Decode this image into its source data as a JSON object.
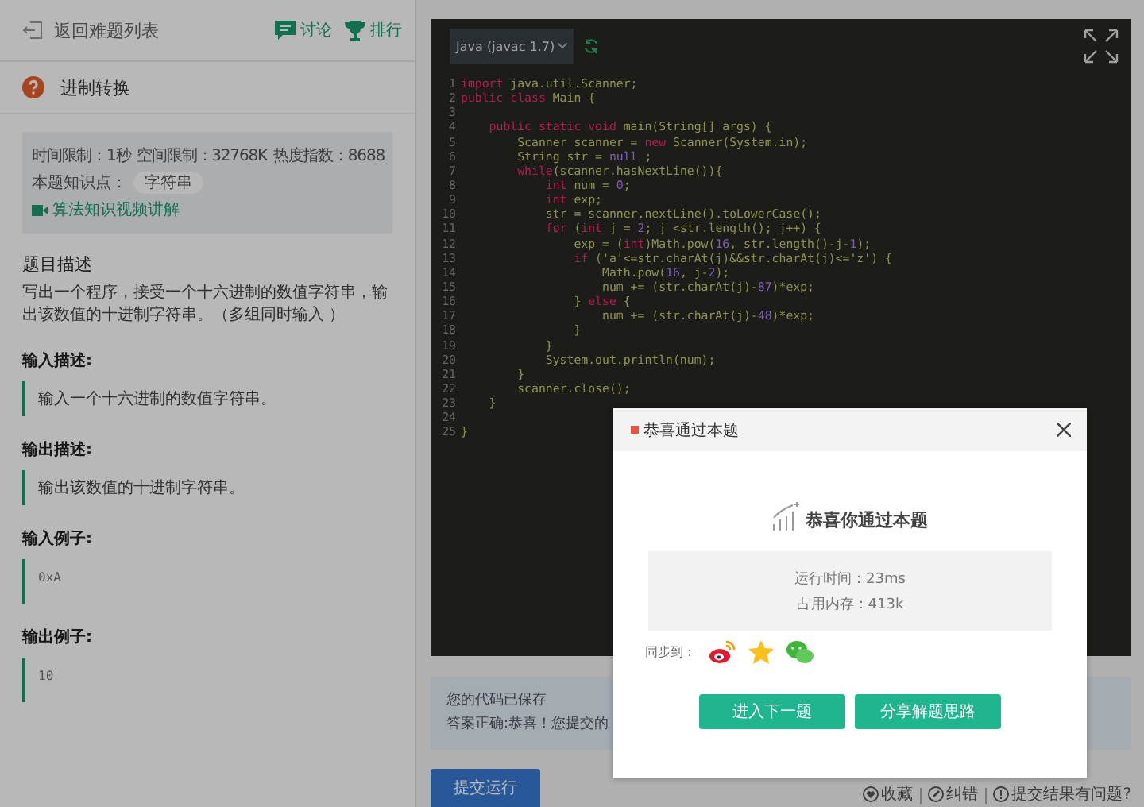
{
  "header": {
    "back_link": "返回难题列表",
    "discuss_link": "讨论",
    "rank_link": "排行"
  },
  "problem": {
    "title": "进制转换",
    "time_limit": "时间限制：1秒",
    "space_limit": "空间限制：32768K",
    "heat_index": "热度指数：8688",
    "knowledge_label": "本题知识点：",
    "knowledge_tag": "字符串",
    "video_link": "算法知识视频讲解"
  },
  "description": {
    "heading": "题目描述",
    "text": "写出一个程序，接受一个十六进制的数值字符串，输出该数值的十进制字符串。（多组同时输入 ）"
  },
  "sections": [
    {
      "heading": "输入描述:",
      "kind": "prose",
      "body": "输入一个十六进制的数值字符串。"
    },
    {
      "heading": "输出描述:",
      "kind": "prose",
      "body": "输出该数值的十进制字符串。"
    },
    {
      "heading": "输入例子:",
      "kind": "code",
      "body": "0xA"
    },
    {
      "heading": "输出例子:",
      "kind": "code",
      "body": "10"
    }
  ],
  "editor": {
    "language": "Java (javac 1.7)",
    "lines": [
      {
        "number": "1",
        "segments": [
          {
            "text": "import",
            "kind": "keyword"
          },
          {
            "text": " java.util.Scanner;",
            "kind": "plain"
          }
        ]
      },
      {
        "number": "2",
        "segments": [
          {
            "text": "public class",
            "kind": "keyword"
          },
          {
            "text": " Main {",
            "kind": "plain"
          }
        ]
      },
      {
        "number": "3"
      },
      {
        "number": "4",
        "segments": [
          {
            "text": "    public static void",
            "kind": "keyword"
          },
          {
            "text": " main(String[] args) {",
            "kind": "plain"
          }
        ]
      },
      {
        "number": "5",
        "segments": [
          {
            "text": "        Scanner scanner = ",
            "kind": "plain"
          },
          {
            "text": "new",
            "kind": "keyword"
          },
          {
            "text": " Scanner(System.in);",
            "kind": "plain"
          }
        ]
      },
      {
        "number": "6",
        "segments": [
          {
            "text": "        String str = ",
            "kind": "plain"
          },
          {
            "text": "null",
            "kind": "number"
          },
          {
            "text": " ;",
            "kind": "plain"
          }
        ]
      },
      {
        "number": "7",
        "segments": [
          {
            "text": "        while",
            "kind": "keyword"
          },
          {
            "text": "(scanner.hasNextLine()){",
            "kind": "plain"
          }
        ]
      },
      {
        "number": "8",
        "segments": [
          {
            "text": "            int",
            "kind": "keyword"
          },
          {
            "text": " num = ",
            "kind": "plain"
          },
          {
            "text": "0",
            "kind": "number"
          },
          {
            "text": ";",
            "kind": "plain"
          }
        ]
      },
      {
        "number": "9",
        "segments": [
          {
            "text": "            int",
            "kind": "keyword"
          },
          {
            "text": " exp;",
            "kind": "plain"
          }
        ]
      },
      {
        "number": "10",
        "segments": [
          {
            "text": "            str = scanner.nextLine().toLowerCase();",
            "kind": "plain"
          }
        ]
      },
      {
        "number": "11",
        "segments": [
          {
            "text": "            for",
            "kind": "keyword"
          },
          {
            "text": " (",
            "kind": "plain"
          },
          {
            "text": "int",
            "kind": "keyword"
          },
          {
            "text": " j = ",
            "kind": "plain"
          },
          {
            "text": "2",
            "kind": "number"
          },
          {
            "text": "; j <str.length(); j++) {",
            "kind": "plain"
          }
        ]
      },
      {
        "number": "12",
        "segments": [
          {
            "text": "                exp = (",
            "kind": "plain"
          },
          {
            "text": "int",
            "kind": "keyword"
          },
          {
            "text": ")Math.pow(",
            "kind": "plain"
          },
          {
            "text": "16",
            "kind": "number"
          },
          {
            "text": ", str.length()-j-",
            "kind": "plain"
          },
          {
            "text": "1",
            "kind": "number"
          },
          {
            "text": ");",
            "kind": "plain"
          }
        ]
      },
      {
        "number": "13",
        "segments": [
          {
            "text": "                if",
            "kind": "keyword"
          },
          {
            "text": " ('a'<=str.charAt(j)&&str.charAt(j)<='z') {",
            "kind": "plain"
          }
        ]
      },
      {
        "number": "14",
        "segments": [
          {
            "text": "                    Math.pow(",
            "kind": "plain"
          },
          {
            "text": "16",
            "kind": "number"
          },
          {
            "text": ", j-",
            "kind": "plain"
          },
          {
            "text": "2",
            "kind": "number"
          },
          {
            "text": ");",
            "kind": "plain"
          }
        ]
      },
      {
        "number": "15",
        "segments": [
          {
            "text": "                    num += (str.charAt(j)-",
            "kind": "plain"
          },
          {
            "text": "87",
            "kind": "number"
          },
          {
            "text": ")*exp;",
            "kind": "plain"
          }
        ]
      },
      {
        "number": "16",
        "segments": [
          {
            "text": "                } ",
            "kind": "plain"
          },
          {
            "text": "else",
            "kind": "keyword"
          },
          {
            "text": " {",
            "kind": "plain"
          }
        ]
      },
      {
        "number": "17",
        "segments": [
          {
            "text": "                    num += (str.charAt(j)-",
            "kind": "plain"
          },
          {
            "text": "48",
            "kind": "number"
          },
          {
            "text": ")*exp;",
            "kind": "plain"
          }
        ]
      },
      {
        "number": "18",
        "segments": [
          {
            "text": "                }",
            "kind": "plain"
          }
        ]
      },
      {
        "number": "19",
        "segments": [
          {
            "text": "            }",
            "kind": "plain"
          }
        ]
      },
      {
        "number": "20",
        "segments": [
          {
            "text": "            System.out.println(num);",
            "kind": "plain"
          }
        ]
      },
      {
        "number": "21",
        "segments": [
          {
            "text": "        }",
            "kind": "plain"
          }
        ]
      },
      {
        "number": "22",
        "segments": [
          {
            "text": "        scanner.close();",
            "kind": "plain"
          }
        ]
      },
      {
        "number": "23",
        "segments": [
          {
            "text": "    }",
            "kind": "plain"
          }
        ]
      },
      {
        "number": "24"
      },
      {
        "number": "25",
        "segments": [
          {
            "text": "}",
            "kind": "plain"
          }
        ]
      }
    ]
  },
  "result": {
    "saved": "您的代码已保存",
    "verdict": "答案正确:恭喜！您提交的"
  },
  "submit_button": "提交运行",
  "footer_links": [
    {
      "label": "收藏",
      "kind": "favorite"
    },
    {
      "label": "纠错",
      "kind": "correct"
    },
    {
      "label": "提交结果有问题?",
      "kind": "report"
    }
  ],
  "dialog": {
    "title": "恭喜通过本题",
    "heading": "恭喜你通过本题",
    "run_time": "运行时间：23ms",
    "memory": "占用内存：413k",
    "share_label": "同步到：",
    "share_targets": [
      {
        "kind": "weibo"
      },
      {
        "kind": "qzone"
      },
      {
        "kind": "wechat"
      }
    ],
    "buttons": [
      "进入下一题",
      "分享解题思路"
    ]
  }
}
